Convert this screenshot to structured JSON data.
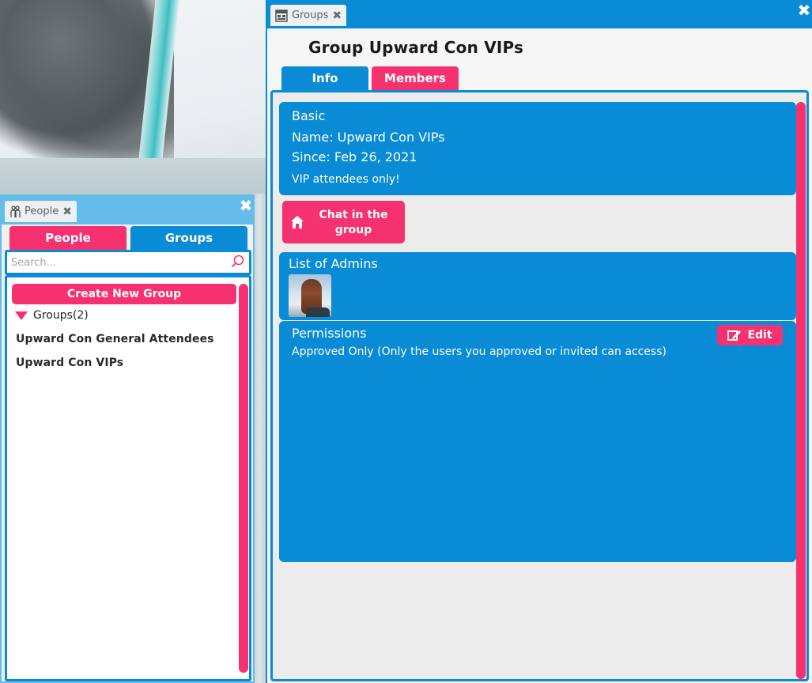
{
  "groups_window": {
    "tab_title": "Groups",
    "title": "Group Upward Con VIPs",
    "tabs": [
      {
        "label": "Info",
        "active": true
      },
      {
        "label": "Members",
        "active": false
      }
    ],
    "basic": {
      "heading": "Basic",
      "name": "Name: Upward Con VIPs",
      "since": "Since: Feb 26, 2021",
      "description": "VIP attendees only!"
    },
    "chat_button": "Chat in the group",
    "admins": {
      "heading": "List of Admins"
    },
    "permissions": {
      "heading": "Permissions",
      "edit_label": "Edit",
      "description": "Approved Only (Only the users you approved or invited can access)"
    }
  },
  "people_window": {
    "tab_title": "People",
    "tabs": [
      {
        "label": "People",
        "active": false
      },
      {
        "label": "Groups",
        "active": true
      }
    ],
    "search": {
      "placeholder": "Search...",
      "value": ""
    },
    "create_button": "Create New Group",
    "groups_header": "Groups(2)",
    "groups": [
      "Upward Con General Attendees",
      "Upward Con VIPs"
    ]
  },
  "colors": {
    "primary_blue": "#0a8bd6",
    "accent_pink": "#f5326f",
    "light_blue_titlebar": "#63bce9"
  },
  "icons": [
    "people-icon",
    "groups-window-icon",
    "close-icon",
    "home-icon",
    "edit-icon",
    "search-icon",
    "collapse-triangle-icon"
  ]
}
